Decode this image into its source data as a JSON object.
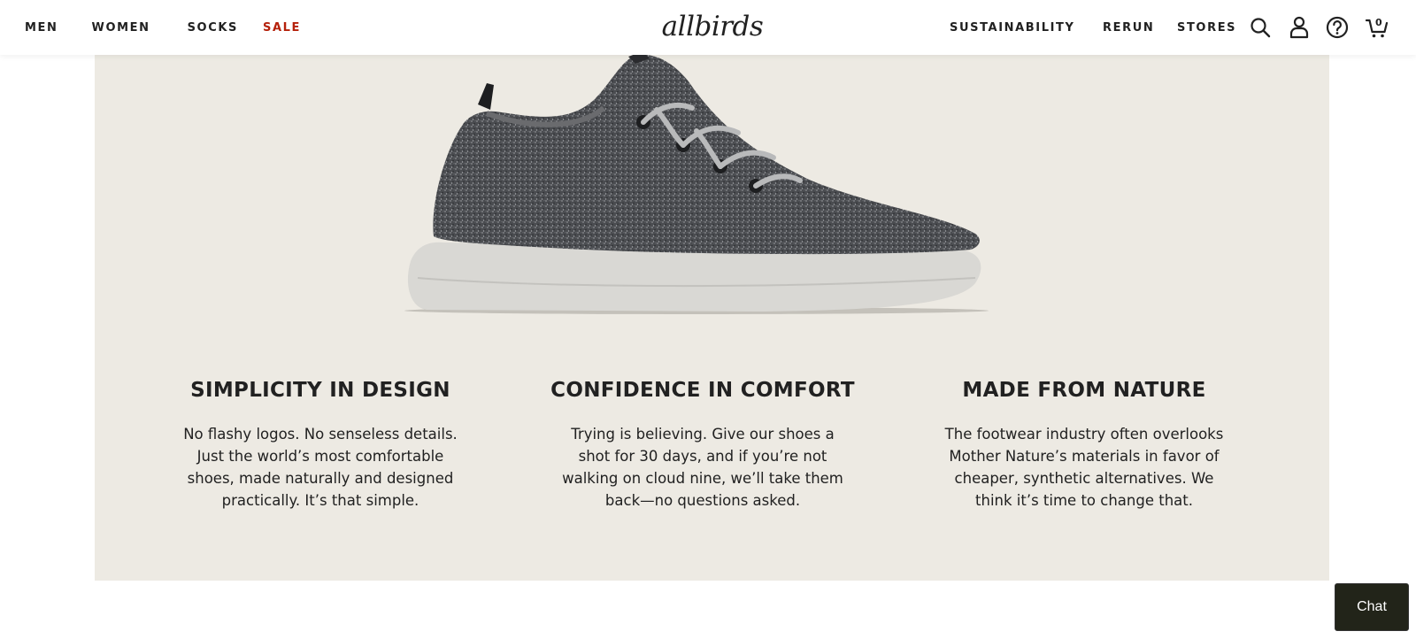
{
  "header": {
    "nav_left": [
      "MEN",
      "WOMEN",
      "SOCKS",
      "SALE"
    ],
    "logo": "allbirds",
    "nav_right": [
      "SUSTAINABILITY",
      "RERUN",
      "STORES"
    ],
    "cart_count": "0",
    "icons": [
      "search-icon",
      "account-icon",
      "help-icon",
      "cart-icon"
    ],
    "sale_color": "#b5210b"
  },
  "hero": {
    "background": "#edeae3",
    "image": "wool-runner-sneaker",
    "features": [
      {
        "title": "SIMPLICITY IN DESIGN",
        "text": "No flashy logos. No senseless details. Just the world’s most comfortable shoes, made naturally and designed practically. It’s that simple."
      },
      {
        "title": "CONFIDENCE IN COMFORT",
        "text": "Trying is believing. Give our shoes a shot for 30 days, and if you’re not walking on cloud nine, we’ll take them back—no questions asked."
      },
      {
        "title": "MADE FROM NATURE",
        "text": "The footwear industry often overlooks Mother Nature’s materials in favor of cheaper, synthetic alternatives. We think it’s time to change that."
      }
    ]
  },
  "chat": {
    "label": "Chat"
  }
}
